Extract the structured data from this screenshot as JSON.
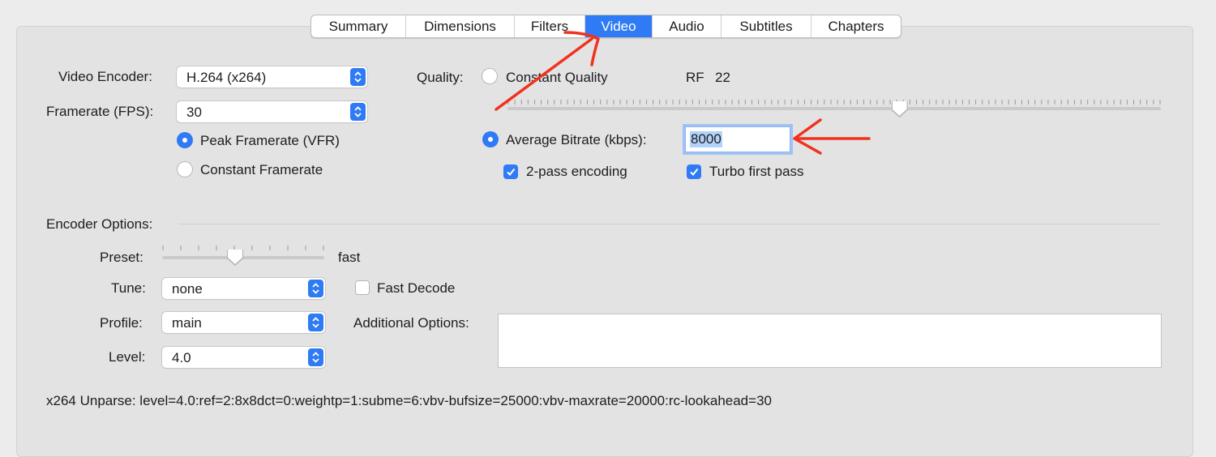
{
  "tabs": [
    "Summary",
    "Dimensions",
    "Filters",
    "Video",
    "Audio",
    "Subtitles",
    "Chapters"
  ],
  "active_tab": "Video",
  "video": {
    "encoder_label": "Video Encoder:",
    "encoder_value": "H.264 (x264)",
    "framerate_label": "Framerate (FPS):",
    "framerate_value": "30",
    "peak_framerate": "Peak Framerate (VFR)",
    "constant_framerate": "Constant Framerate"
  },
  "quality": {
    "label": "Quality:",
    "constant_quality": "Constant Quality",
    "rf_label": "RF",
    "rf_value": "22",
    "rf_slider_fraction": 0.6,
    "average_bitrate": "Average Bitrate (kbps):",
    "bitrate_value": "8000",
    "two_pass": "2-pass encoding",
    "turbo": "Turbo first pass"
  },
  "encoder_options": {
    "heading": "Encoder Options:",
    "preset_label": "Preset:",
    "preset_value": "fast",
    "preset_fraction": 0.45,
    "tune_label": "Tune:",
    "tune_value": "none",
    "fast_decode": "Fast Decode",
    "profile_label": "Profile:",
    "profile_value": "main",
    "additional_label": "Additional Options:",
    "level_label": "Level:",
    "level_value": "4.0"
  },
  "unparse": "x264 Unparse: level=4.0:ref=2:8x8dct=0:weightp=1:subme=6:vbv-bufsize=25000:vbv-maxrate=20000:rc-lookahead=30",
  "colors": {
    "accent": "#2f7bf5",
    "annotation": "#f0321e"
  }
}
